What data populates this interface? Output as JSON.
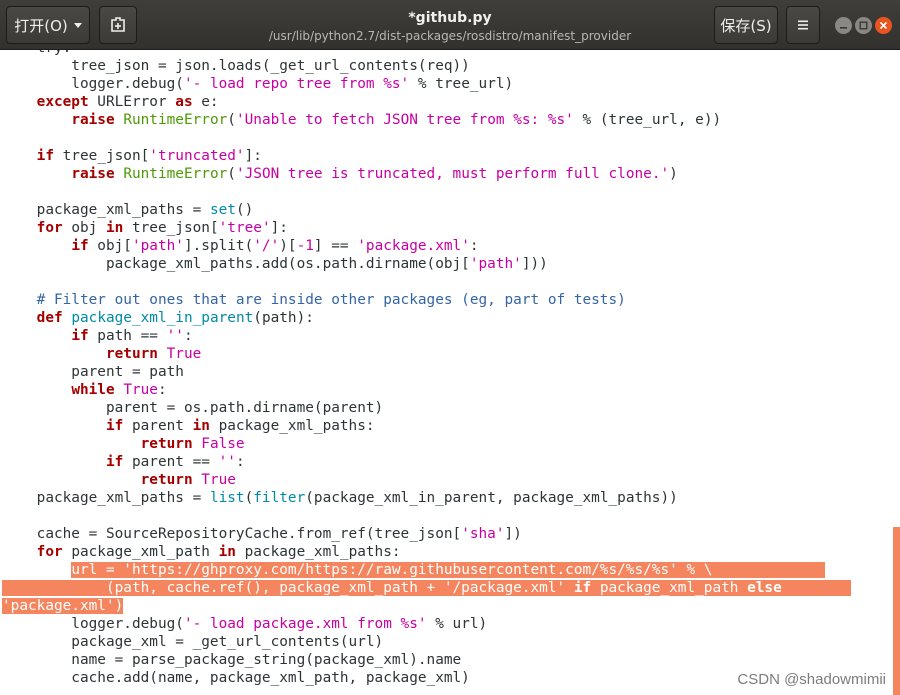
{
  "header": {
    "open_label": "打开(O)",
    "title": "*github.py",
    "subtitle": "/usr/lib/python2.7/dist-packages/rosdistro/manifest_provider",
    "save_label": "保存(S)",
    "icons": {
      "open_dropdown": "chevron-down-icon",
      "new_tab": "new-document-icon",
      "menu": "hamburger-menu-icon",
      "minimize": "minimize-icon",
      "maximize": "maximize-icon",
      "close": "close-icon"
    }
  },
  "editor": {
    "selection_color": "#f4855e",
    "lines": [
      {
        "t": [
          [
            "    ",
            ""
          ],
          [
            "try",
            ""
          ],
          [
            ":",
            ""
          ]
        ]
      },
      {
        "t": [
          [
            "        tree_json = json.loads(_get_url_contents(req))",
            ""
          ]
        ]
      },
      {
        "t": [
          [
            "        logger.debug(",
            ""
          ],
          [
            "'- load repo tree from %s'",
            "str"
          ],
          [
            " % tree_url)",
            ""
          ]
        ]
      },
      {
        "t": [
          [
            "    ",
            ""
          ],
          [
            "except",
            "kw"
          ],
          [
            " URLError ",
            ""
          ],
          [
            "as",
            "kw"
          ],
          [
            " e:",
            ""
          ]
        ]
      },
      {
        "t": [
          [
            "        ",
            ""
          ],
          [
            "raise",
            "kw"
          ],
          [
            " ",
            ""
          ],
          [
            "RuntimeError",
            "bi"
          ],
          [
            "(",
            ""
          ],
          [
            "'Unable to fetch JSON tree from %s: %s'",
            "str"
          ],
          [
            " % (tree_url, e))",
            ""
          ]
        ]
      },
      {
        "t": []
      },
      {
        "t": [
          [
            "    ",
            ""
          ],
          [
            "if",
            "kw"
          ],
          [
            " tree_json[",
            ""
          ],
          [
            "'truncated'",
            "str"
          ],
          [
            "]:",
            ""
          ]
        ]
      },
      {
        "t": [
          [
            "        ",
            ""
          ],
          [
            "raise",
            "kw"
          ],
          [
            " ",
            ""
          ],
          [
            "RuntimeError",
            "bi"
          ],
          [
            "(",
            ""
          ],
          [
            "'JSON tree is truncated, must perform full clone.'",
            "str"
          ],
          [
            ")",
            ""
          ]
        ]
      },
      {
        "t": []
      },
      {
        "t": [
          [
            "    package_xml_paths = ",
            ""
          ],
          [
            "set",
            "fn"
          ],
          [
            "()",
            ""
          ]
        ]
      },
      {
        "t": [
          [
            "    ",
            ""
          ],
          [
            "for",
            "kw"
          ],
          [
            " obj ",
            ""
          ],
          [
            "in",
            "kw"
          ],
          [
            " tree_json[",
            ""
          ],
          [
            "'tree'",
            "str"
          ],
          [
            "]:",
            ""
          ]
        ]
      },
      {
        "t": [
          [
            "        ",
            ""
          ],
          [
            "if",
            "kw"
          ],
          [
            " obj[",
            ""
          ],
          [
            "'path'",
            "str"
          ],
          [
            "].split(",
            ""
          ],
          [
            "'/'",
            "str"
          ],
          [
            ")[",
            ""
          ],
          [
            "-1",
            "str"
          ],
          [
            "] == ",
            ""
          ],
          [
            "'package.xml'",
            "str"
          ],
          [
            ":",
            ""
          ]
        ]
      },
      {
        "t": [
          [
            "            package_xml_paths.add(os.path.dirname(obj[",
            ""
          ],
          [
            "'path'",
            "str"
          ],
          [
            "]))",
            ""
          ]
        ]
      },
      {
        "t": []
      },
      {
        "t": [
          [
            "    ",
            ""
          ],
          [
            "# Filter out ones that are inside other packages (eg, part of tests)",
            "cm"
          ]
        ]
      },
      {
        "t": [
          [
            "    ",
            ""
          ],
          [
            "def",
            "kw"
          ],
          [
            " ",
            ""
          ],
          [
            "package_xml_in_parent",
            "fn"
          ],
          [
            "(path):",
            ""
          ]
        ]
      },
      {
        "t": [
          [
            "        ",
            ""
          ],
          [
            "if",
            "kw"
          ],
          [
            " path == ",
            ""
          ],
          [
            "''",
            "str"
          ],
          [
            ":",
            ""
          ]
        ]
      },
      {
        "t": [
          [
            "            ",
            ""
          ],
          [
            "return",
            "kw"
          ],
          [
            " ",
            ""
          ],
          [
            "True",
            "str"
          ]
        ]
      },
      {
        "t": [
          [
            "        parent = path",
            ""
          ]
        ]
      },
      {
        "t": [
          [
            "        ",
            ""
          ],
          [
            "while",
            "kw"
          ],
          [
            " ",
            ""
          ],
          [
            "True",
            "str"
          ],
          [
            ":",
            ""
          ]
        ]
      },
      {
        "t": [
          [
            "            parent = os.path.dirname(parent)",
            ""
          ]
        ]
      },
      {
        "t": [
          [
            "            ",
            ""
          ],
          [
            "if",
            "kw"
          ],
          [
            " parent ",
            ""
          ],
          [
            "in",
            "kw"
          ],
          [
            " package_xml_paths:",
            ""
          ]
        ]
      },
      {
        "t": [
          [
            "                ",
            ""
          ],
          [
            "return",
            "kw"
          ],
          [
            " ",
            ""
          ],
          [
            "False",
            "str"
          ]
        ]
      },
      {
        "t": [
          [
            "            ",
            ""
          ],
          [
            "if",
            "kw"
          ],
          [
            " parent == ",
            ""
          ],
          [
            "''",
            "str"
          ],
          [
            ":",
            ""
          ]
        ]
      },
      {
        "t": [
          [
            "                ",
            ""
          ],
          [
            "return",
            "kw"
          ],
          [
            " ",
            ""
          ],
          [
            "True",
            "str"
          ]
        ]
      },
      {
        "t": [
          [
            "    package_xml_paths = ",
            ""
          ],
          [
            "list",
            "fn"
          ],
          [
            "(",
            ""
          ],
          [
            "filter",
            "fn"
          ],
          [
            "(package_xml_in_parent, package_xml_paths))",
            ""
          ]
        ]
      },
      {
        "t": []
      },
      {
        "t": [
          [
            "    cache = SourceRepositoryCache.from_ref(tree_json[",
            ""
          ],
          [
            "'sha'",
            "str"
          ],
          [
            "])",
            ""
          ]
        ]
      },
      {
        "t": [
          [
            "    ",
            ""
          ],
          [
            "for",
            "kw"
          ],
          [
            " package_xml_path ",
            ""
          ],
          [
            "in",
            "kw"
          ],
          [
            " package_xml_paths:",
            ""
          ]
        ]
      },
      {
        "pre": "        ",
        "sel": true,
        "t": [
          [
            "url = ",
            ""
          ],
          [
            "'https://ghproxy.com/https://raw.githubusercontent.com/%s/%s/%s'",
            "str"
          ],
          [
            " % \\",
            ""
          ]
        ],
        "post": "             "
      },
      {
        "sel": true,
        "t": [
          [
            "            (path, cache.ref(), package_xml_path + ",
            ""
          ],
          [
            "'/package.xml'",
            "str"
          ],
          [
            " ",
            ""
          ],
          [
            "if",
            "kw"
          ],
          [
            " package_xml_path ",
            ""
          ],
          [
            "else",
            "kw"
          ]
        ],
        "post": "        "
      },
      {
        "sel": true,
        "t": [
          [
            "'package.xml'",
            "str"
          ],
          [
            ")",
            ""
          ]
        ]
      },
      {
        "t": [
          [
            "        logger.debug(",
            ""
          ],
          [
            "'- load package.xml from %s'",
            "str"
          ],
          [
            " % url)",
            ""
          ]
        ]
      },
      {
        "t": [
          [
            "        package_xml = _get_url_contents(url)",
            ""
          ]
        ]
      },
      {
        "t": [
          [
            "        name = parse_package_string(package_xml).name",
            ""
          ]
        ]
      },
      {
        "t": [
          [
            "        cache.add(name, package_xml_path, package_xml)",
            ""
          ]
        ]
      }
    ]
  },
  "watermark": "CSDN @shadowmimii"
}
